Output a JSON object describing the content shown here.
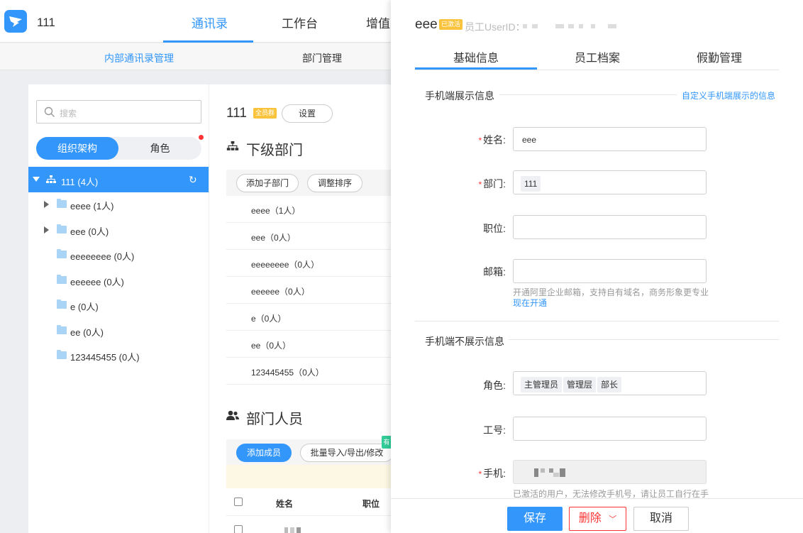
{
  "header": {
    "org_name": "111",
    "tabs": [
      {
        "label": "通讯录",
        "active": true
      },
      {
        "label": "工作台",
        "active": false
      },
      {
        "label": "增值",
        "active": false
      }
    ]
  },
  "subnav": {
    "tabs": [
      {
        "label": "内部通讯录管理",
        "active": true
      },
      {
        "label": "部门管理",
        "active": false
      }
    ]
  },
  "sidebar": {
    "search_placeholder": "搜索",
    "segments": {
      "org": "组织架构",
      "role": "角色"
    },
    "root": {
      "label": "111 (4人)"
    },
    "items": [
      {
        "label": "eeee (1人)",
        "expandable": true
      },
      {
        "label": "eee (0人)",
        "expandable": true
      },
      {
        "label": "eeeeeeee (0人)",
        "expandable": false
      },
      {
        "label": "eeeeee (0人)",
        "expandable": false
      },
      {
        "label": "e (0人)",
        "expandable": false
      },
      {
        "label": "ee (0人)",
        "expandable": false
      },
      {
        "label": "123445455 (0人)",
        "expandable": false
      }
    ]
  },
  "main": {
    "title": "111",
    "badge": "全员群",
    "settings_button": "设置",
    "subdept_heading": "下级部门",
    "add_subdept_button": "添加子部门",
    "sort_button": "调整排序",
    "subdepts": [
      "eeee（1人）",
      "eee（0人）",
      "eeeeeeee（0人）",
      "eeeeee（0人）",
      "e（0人）",
      "ee（0人）",
      "123445455（0人）"
    ],
    "members_heading": "部门人员",
    "add_member_button": "添加成员",
    "batch_button": "批量导入/导出/修改",
    "new_tag": "有",
    "table_headers": {
      "name": "姓名",
      "position": "职位"
    }
  },
  "drawer": {
    "name": "eee",
    "status_badge": "已激活",
    "userid_label": "员工UserID：",
    "tabs": [
      {
        "label": "基础信息",
        "active": true
      },
      {
        "label": "员工档案",
        "active": false
      },
      {
        "label": "假勤管理",
        "active": false
      }
    ],
    "mobile_shown_title": "手机端展示信息",
    "customize_link": "自定义手机端展示的信息",
    "fields": {
      "name": {
        "label": "姓名:",
        "value": "eee",
        "required": true
      },
      "dept": {
        "label": "部门:",
        "chip": "111",
        "required": true
      },
      "position": {
        "label": "职位:",
        "value": ""
      },
      "email": {
        "label": "邮箱:",
        "value": ""
      }
    },
    "email_hint": "开通阿里企业邮箱，支持自有域名，商务形象更专业",
    "email_link": "现在开通",
    "mobile_hidden_title": "手机端不展示信息",
    "role": {
      "label": "角色:",
      "chips": [
        "主管理员",
        "管理层",
        "部长"
      ]
    },
    "job_no": {
      "label": "工号:",
      "value": ""
    },
    "phone": {
      "label": "手机:",
      "required": true
    },
    "phone_hint": "已激活的用户，无法修改手机号，请让员工自行在手",
    "buttons": {
      "save": "保存",
      "delete": "删除",
      "cancel": "取消"
    }
  },
  "colors": {
    "accent": "#3296fa",
    "danger": "#ff3333",
    "badge": "#f9c33b"
  }
}
